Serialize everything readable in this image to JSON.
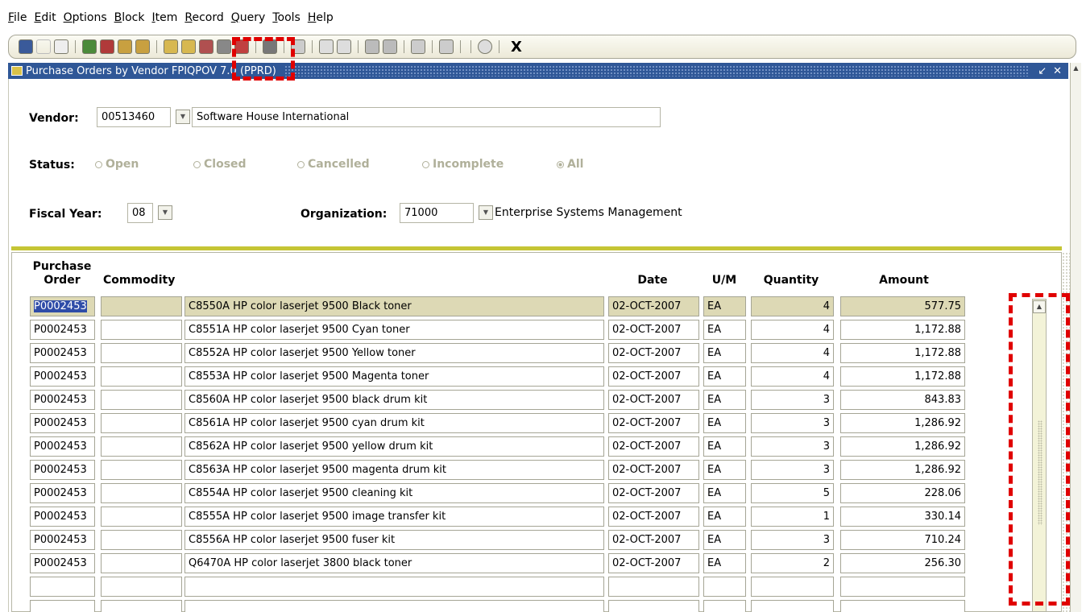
{
  "menu": [
    "File",
    "Edit",
    "Options",
    "Block",
    "Item",
    "Record",
    "Query",
    "Tools",
    "Help"
  ],
  "toolbar": {
    "exit_label": "X"
  },
  "window": {
    "title": "Purchase Orders by Vendor  FPIQPOV  7.0  (PPRD)",
    "minimize": "↙",
    "close": "✕"
  },
  "vendor": {
    "label": "Vendor:",
    "id": "00513460",
    "name": "Software House International"
  },
  "status": {
    "label": "Status:",
    "options": [
      "Open",
      "Closed",
      "Cancelled",
      "Incomplete",
      "All"
    ],
    "selected": "All"
  },
  "fiscal_year": {
    "label": "Fiscal Year:",
    "value": "08"
  },
  "organization": {
    "label": "Organization:",
    "code": "71000",
    "name": "Enterprise Systems Management"
  },
  "grid": {
    "headers": {
      "po_line1": "Purchase",
      "po_line2": "Order",
      "commodity": "Commodity",
      "date": "Date",
      "um": "U/M",
      "quantity": "Quantity",
      "amount": "Amount"
    },
    "rows": [
      {
        "po": "P0002453",
        "commodity": "",
        "desc": "C8550A HP color laserjet 9500 Black toner",
        "date": "02-OCT-2007",
        "um": "EA",
        "qty": "4",
        "amount": "577.75"
      },
      {
        "po": "P0002453",
        "commodity": "",
        "desc": "C8551A HP color laserjet 9500 Cyan toner",
        "date": "02-OCT-2007",
        "um": "EA",
        "qty": "4",
        "amount": "1,172.88"
      },
      {
        "po": "P0002453",
        "commodity": "",
        "desc": "C8552A HP color laserjet 9500 Yellow toner",
        "date": "02-OCT-2007",
        "um": "EA",
        "qty": "4",
        "amount": "1,172.88"
      },
      {
        "po": "P0002453",
        "commodity": "",
        "desc": "C8553A HP color laserjet 9500 Magenta toner",
        "date": "02-OCT-2007",
        "um": "EA",
        "qty": "4",
        "amount": "1,172.88"
      },
      {
        "po": "P0002453",
        "commodity": "",
        "desc": "C8560A HP color laserjet 9500 black drum kit",
        "date": "02-OCT-2007",
        "um": "EA",
        "qty": "3",
        "amount": "843.83"
      },
      {
        "po": "P0002453",
        "commodity": "",
        "desc": "C8561A HP color laserjet 9500 cyan drum kit",
        "date": "02-OCT-2007",
        "um": "EA",
        "qty": "3",
        "amount": "1,286.92"
      },
      {
        "po": "P0002453",
        "commodity": "",
        "desc": "C8562A HP color laserjet 9500 yellow drum kit",
        "date": "02-OCT-2007",
        "um": "EA",
        "qty": "3",
        "amount": "1,286.92"
      },
      {
        "po": "P0002453",
        "commodity": "",
        "desc": "C8563A HP color laserjet 9500 magenta drum kit",
        "date": "02-OCT-2007",
        "um": "EA",
        "qty": "3",
        "amount": "1,286.92"
      },
      {
        "po": "P0002453",
        "commodity": "",
        "desc": "C8554A HP color laserjet 9500 cleaning kit",
        "date": "02-OCT-2007",
        "um": "EA",
        "qty": "5",
        "amount": "228.06"
      },
      {
        "po": "P0002453",
        "commodity": "",
        "desc": "C8555A HP color laserjet 9500 image transfer kit",
        "date": "02-OCT-2007",
        "um": "EA",
        "qty": "1",
        "amount": "330.14"
      },
      {
        "po": "P0002453",
        "commodity": "",
        "desc": "C8556A HP color laserjet 9500 fuser kit",
        "date": "02-OCT-2007",
        "um": "EA",
        "qty": "3",
        "amount": "710.24"
      },
      {
        "po": "P0002453",
        "commodity": "",
        "desc": "Q6470A HP color laserjet 3800 black toner",
        "date": "02-OCT-2007",
        "um": "EA",
        "qty": "2",
        "amount": "256.30"
      },
      {
        "po": "",
        "commodity": "",
        "desc": "",
        "date": "",
        "um": "",
        "qty": "",
        "amount": ""
      },
      {
        "po": "",
        "commodity": "",
        "desc": "",
        "date": "",
        "um": "",
        "qty": "",
        "amount": ""
      }
    ]
  },
  "colors": {
    "title_bar": "#2f5797",
    "separator": "#c5c535",
    "selected_row": "#ddd9b5",
    "highlight": "#e00000"
  }
}
